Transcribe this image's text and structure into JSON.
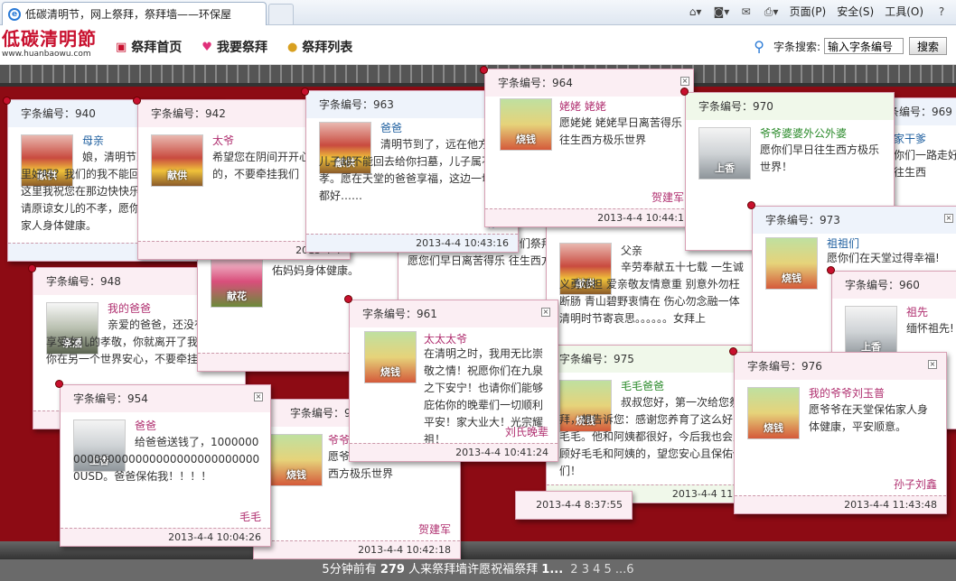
{
  "browser": {
    "tab_title": "低碳清明节，网上祭拜，祭拜墙——环保屋",
    "tools": [
      "页面(P)",
      "安全(S)",
      "工具(O)"
    ]
  },
  "site": {
    "logo_name": "低碳清明節",
    "logo_url": "www.huanbaowu.com",
    "nav": [
      "祭拜首页",
      "我要祭拜",
      "祭拜列表"
    ],
    "search_label": "字条搜索:",
    "search_value": "输入字条编号",
    "search_button": "搜索"
  },
  "footer": {
    "prefix": "5分钟前有",
    "count": "279",
    "suffix": "人来祭拜墙许愿祝福祭拜",
    "current": "1...",
    "pages": "2 3 4 5 ...6"
  },
  "notes": [
    {
      "no": "字条编号：940",
      "img": "献供",
      "to": "母亲",
      "msg": "娘，清明节到了，你在那里好吗？我们的我不能回去陪你，我在这里我祝您在那边快快乐，没有忧愁。请原谅女儿的不孝，愿你在天堂保佑全家人身体健康。",
      "sig": "",
      "time": "2013-4-4"
    },
    {
      "no": "字条编号：942",
      "img": "献供",
      "to": "太爷",
      "msg": "希望您在阴间开开心心的，不要牵挂我们",
      "sig": "",
      "time": ""
    },
    {
      "no": "字条编号：963",
      "img": "献供",
      "to": "爸爸",
      "msg": "清明节到了，远在他方的儿子却不能回去给你扫墓，儿子属不孝。愿在天堂的爸爸享福，这边一切也都好……",
      "sig": "你的",
      "time": "2013-4-4 10:43:16"
    },
    {
      "no": "字条编号：964",
      "img": "烧钱",
      "to": "姥姥 姥姥",
      "msg": "愿姥姥 姥姥早日离苦得乐 往生西方极乐世界",
      "sig": "贺建军",
      "time": "2013-4-4 10:44:1"
    },
    {
      "no": "字条编号：970",
      "img": "上香",
      "to": "爷爷婆婆外公外婆",
      "msg": "愿你们早日往生西方极乐世界！",
      "sig": "",
      "time": ""
    },
    {
      "no": "字条编号：969",
      "img": "",
      "to": "老家干爹",
      "msg": "愿你们一路走好得乐往生西",
      "sig": "",
      "time": ""
    },
    {
      "no": "字条编号：973",
      "img": "烧钱",
      "to": "祖祖们",
      "msg": "愿你们在天堂过得幸福!",
      "sig": "",
      "time": ""
    },
    {
      "no": "字条编号：960",
      "img": "上香",
      "to": "祖先",
      "msg": "缅怀祖先!",
      "sig": "",
      "time": ""
    },
    {
      "no": "字条编号：948",
      "img": "祭酒",
      "to": "我的爸爸",
      "msg": "亲爱的爸爸，还没有好好享受女儿的孝敬，你就离开了我们，愿你在另一个世界安心，不要牵挂我们。",
      "sig": "",
      "time": ""
    },
    {
      "no": "",
      "img": "献花",
      "to": "",
      "msg": "佑妈妈身体健康。",
      "sig": "",
      "time": ""
    },
    {
      "no": "",
      "img": "",
      "to": "",
      "msg": "今天是清明节 孙子给你们祭拜了！ 孙子愿您们早日离苦得乐 往生西方极乐世",
      "sig": "",
      "time": ""
    },
    {
      "no": "",
      "img": "献供",
      "to": "父亲",
      "msg": "辛劳奉献五十七载 一生诚义勇承担 爱亲敬友情意重 别意外勿枉断肠 青山碧野衷情在 伤心勿念融一体 清明时节寄哀思。。。。。。女拜上",
      "sig": "",
      "time": ""
    },
    {
      "no": "字条编号：961",
      "img": "烧钱",
      "to": "太太太爷",
      "msg": "在清明之时，我用无比崇敬之情！祝愿你们在九泉之下安宁！也请你们能够庇佑你的晚辈们一切顺利平安！家大业大！光宗耀祖！",
      "sig": "刘氏晚辈",
      "time": "2013-4-4 10:41:24"
    },
    {
      "no": "字条编号：975",
      "img": "烧钱",
      "to": "毛毛爸爸",
      "msg": "叔叔您好，第一次给您祭拜，想告诉您：感谢您养育了这么好的毛毛。他和阿姨都很好，今后我也会照顾好毛毛和阿姨的，望您安心且保佑他们！",
      "sig": "",
      "time": "2013-4-4 11:33"
    },
    {
      "no": "字条编号：954",
      "img": "上香",
      "to": "爸爸",
      "msg": "给爸爸送钱了，10000000000000000000000000000000000USD。爸爸保佑我！！！！",
      "sig": "毛毛",
      "time": "2013-4-4 10:04:26"
    },
    {
      "no": "字条编号：962",
      "img": "烧钱",
      "to": "爷爷",
      "msg": "愿爷爷早日离苦得乐 往生西方极乐世界",
      "sig": "贺建军",
      "time": "2013-4-4 10:42:18"
    },
    {
      "no": "字条编号：976",
      "img": "烧钱",
      "to": "我的爷爷刘玉普",
      "msg": "愿爷爷在天堂保佑家人身体健康，平安顺意。",
      "sig": "孙子刘鑫",
      "time": "2013-4-4 11:43:48"
    }
  ],
  "extra_times": [
    "2013-4-4 8:37:55",
    "2013-4-4"
  ]
}
